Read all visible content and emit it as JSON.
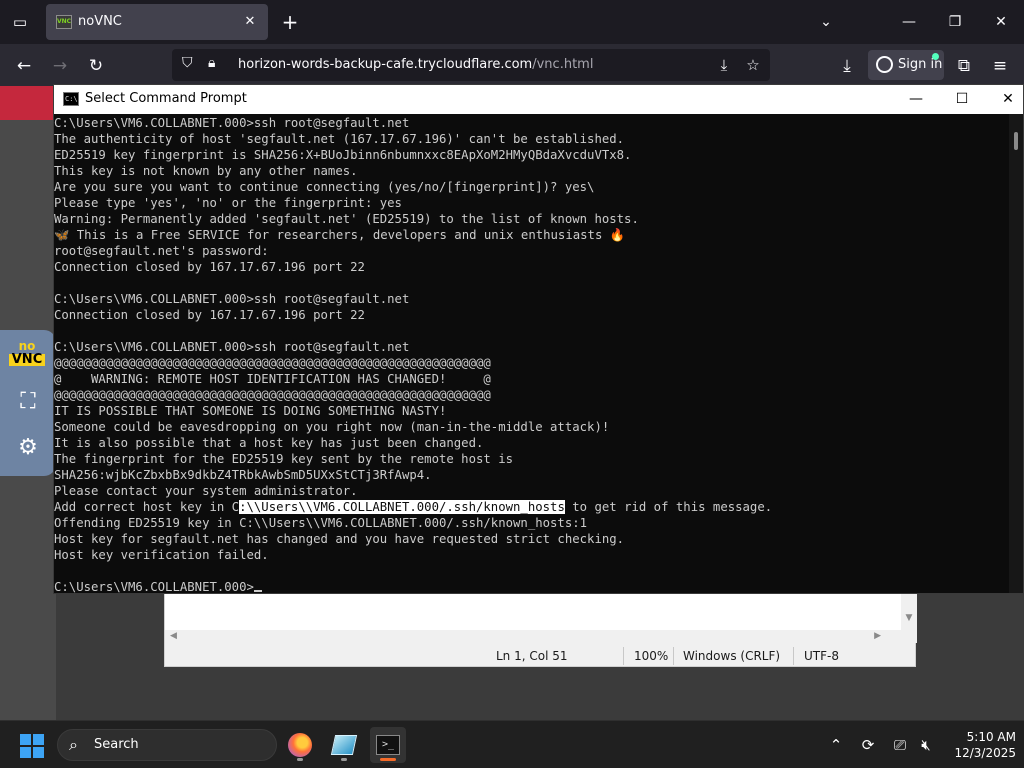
{
  "browser": {
    "tab_title": "noVNC",
    "tab_favicon_text": "VNC",
    "url_host": "horizon-words-backup-cafe.trycloudflare.com",
    "url_path": "/vnc.html",
    "signin_label": "Sign in",
    "accent_color": "#54ffbd"
  },
  "novnc": {
    "logo_top": "no",
    "logo_bottom": "VNC"
  },
  "cmd": {
    "title": "Select Command Prompt",
    "icon_text": "C:\\",
    "lines": [
      "C:\\Users\\VM6.COLLABNET.000>ssh root@segfault.net",
      "The authenticity of host 'segfault.net (167.17.67.196)' can't be established.",
      "ED25519 key fingerprint is SHA256:X+BUoJbinn6nbumnxxc8EApXoM2HMyQBdaXvcduVTx8.",
      "This key is not known by any other names.",
      "Are you sure you want to continue connecting (yes/no/[fingerprint])? yes\\",
      "Please type 'yes', 'no' or the fingerprint: yes",
      "Warning: Permanently added 'segfault.net' (ED25519) to the list of known hosts.",
      "🦋 This is a Free SERVICE for researchers, developers and unix enthusiasts 🔥",
      "root@segfault.net's password:",
      "Connection closed by 167.17.67.196 port 22",
      "",
      "C:\\Users\\VM6.COLLABNET.000>ssh root@segfault.net",
      "Connection closed by 167.17.67.196 port 22",
      "",
      "C:\\Users\\VM6.COLLABNET.000>ssh root@segfault.net",
      "@@@@@@@@@@@@@@@@@@@@@@@@@@@@@@@@@@@@@@@@@@@@@@@@@@@@@@@@@@@",
      "@    WARNING: REMOTE HOST IDENTIFICATION HAS CHANGED!     @",
      "@@@@@@@@@@@@@@@@@@@@@@@@@@@@@@@@@@@@@@@@@@@@@@@@@@@@@@@@@@@",
      "IT IS POSSIBLE THAT SOMEONE IS DOING SOMETHING NASTY!",
      "Someone could be eavesdropping on you right now (man-in-the-middle attack)!",
      "It is also possible that a host key has just been changed.",
      "The fingerprint for the ED25519 key sent by the remote host is",
      "SHA256:wjbKcZbxbBx9dkbZ4TRbkAwbSmD5UXxStCTj3RfAwp4.",
      "Please contact your system administrator."
    ],
    "hostkey_line_prefix": "Add correct host key in C",
    "hostkey_line_selected": ":\\\\Users\\\\VM6.COLLABNET.000/.ssh/known_hosts",
    "hostkey_line_suffix": " to get rid of this message.",
    "lines_after": [
      "Offending ED25519 key in C:\\\\Users\\\\VM6.COLLABNET.000/.ssh/known_hosts:1",
      "Host key for segfault.net has changed and you have requested strict checking.",
      "Host key verification failed.",
      ""
    ],
    "prompt": "C:\\Users\\VM6.COLLABNET.000>"
  },
  "notepad": {
    "position": "Ln 1, Col 51",
    "zoom": "100%",
    "line_endings": "Windows (CRLF)",
    "encoding": "UTF-8"
  },
  "taskbar": {
    "search_label": "Search",
    "time": "5:10 AM",
    "date": "12/3/2025",
    "start_color": "#3da4f5"
  }
}
